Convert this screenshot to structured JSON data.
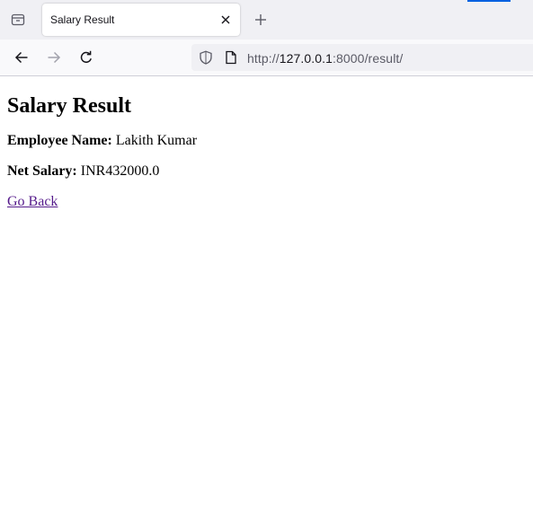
{
  "browser": {
    "tab": {
      "title": "Salary Result"
    },
    "url": {
      "prefix": "http://",
      "host": "127.0.0.1",
      "rest": ":8000/result/"
    },
    "accent_color": "#0061e0",
    "icons": {
      "tab_list": "tab-list-icon",
      "close": "close-icon",
      "new_tab": "plus-icon",
      "back": "back-arrow-icon",
      "forward": "forward-arrow-icon",
      "reload": "reload-icon",
      "shield": "shield-icon",
      "page": "page-icon"
    }
  },
  "page": {
    "heading": "Salary Result",
    "employee_label": "Employee Name:",
    "employee_value": "Lakith Kumar",
    "salary_label": "Net Salary:",
    "salary_value": "INR432000.0",
    "back_link": "Go Back",
    "link_color": "#551a8b"
  }
}
